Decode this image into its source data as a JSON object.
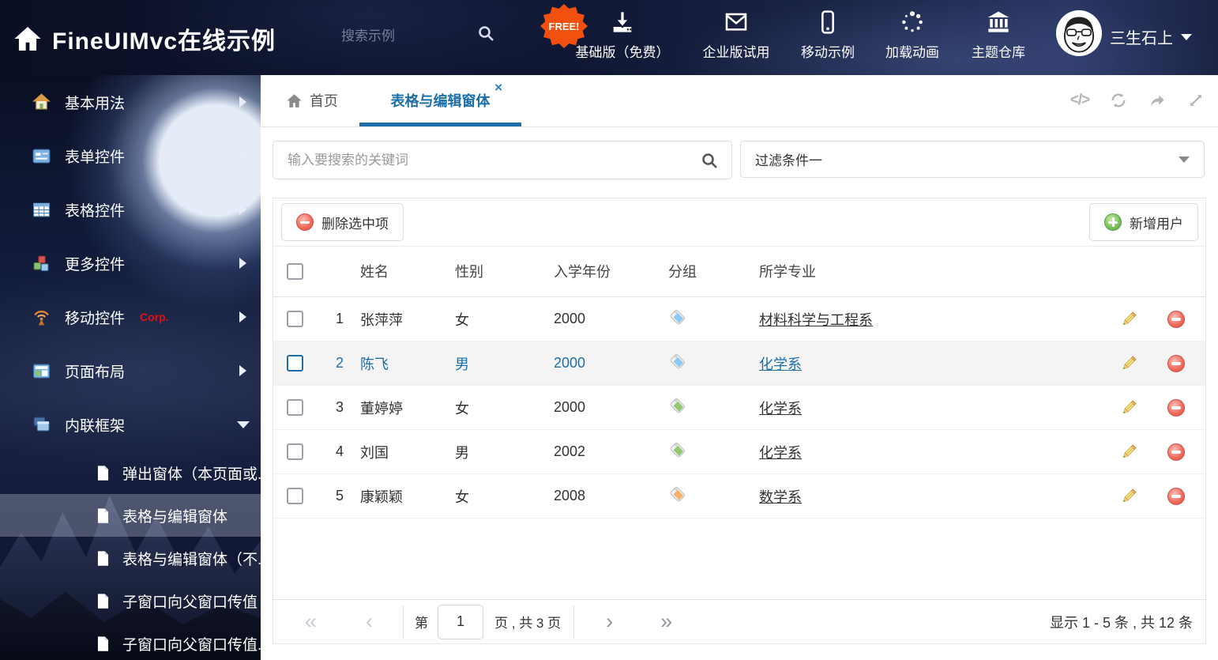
{
  "colors": {
    "accent": "#1d6fa9",
    "selected_row_bg": "#f4f4f5",
    "free_badge": "#f1500e"
  },
  "icons": {
    "close_tab": "×",
    "code": "</>",
    "first_page": "«",
    "prev_page": "‹",
    "next_page": "›",
    "last_page": "»"
  },
  "header": {
    "title": "FineUIMvc在线示例",
    "search_placeholder": "搜索示例",
    "free_badge": "FREE!",
    "nav_items": [
      {
        "label": "基础版（免费）",
        "icon": "download-icon"
      },
      {
        "label": "企业版试用",
        "icon": "envelope-icon"
      },
      {
        "label": "移动示例",
        "icon": "mobile-icon"
      },
      {
        "label": "加载动画",
        "icon": "spinner-icon"
      },
      {
        "label": "主题仓库",
        "icon": "bank-icon"
      }
    ],
    "user_name": "三生石上"
  },
  "sidebar": {
    "items": [
      {
        "label": "基本用法"
      },
      {
        "label": "表单控件"
      },
      {
        "label": "表格控件"
      },
      {
        "label": "更多控件"
      },
      {
        "label": "移动控件",
        "badge": "Corp."
      },
      {
        "label": "页面布局"
      },
      {
        "label": "内联框架",
        "expanded": true
      }
    ],
    "subitems": [
      {
        "label": "弹出窗体（本页面或...",
        "active": false
      },
      {
        "label": "表格与编辑窗体",
        "active": true
      },
      {
        "label": "表格与编辑窗体（不...",
        "active": false
      },
      {
        "label": "子窗口向父窗口传值",
        "active": false
      },
      {
        "label": "子窗口向父窗口传值...",
        "active": false
      }
    ]
  },
  "tabs": {
    "home": "首页",
    "active_tab": "表格与编辑窗体"
  },
  "filter": {
    "search_placeholder": "输入要搜索的关键词",
    "dropdown_value": "过滤条件一"
  },
  "grid": {
    "delete_button": "删除选中项",
    "add_button": "新增用户",
    "columns": [
      "姓名",
      "性别",
      "入学年份",
      "分组",
      "所学专业"
    ],
    "rows": [
      {
        "num": "1",
        "name": "张萍萍",
        "gender": "女",
        "year": "2000",
        "tag_color": "#8cc8ef",
        "major": "材料科学与工程系",
        "selected": false
      },
      {
        "num": "2",
        "name": "陈飞",
        "gender": "男",
        "year": "2000",
        "tag_color": "#8cc8ef",
        "major": "化学系",
        "selected": true
      },
      {
        "num": "3",
        "name": "董婷婷",
        "gender": "女",
        "year": "2000",
        "tag_color": "#94c973",
        "major": "化学系",
        "selected": false
      },
      {
        "num": "4",
        "name": "刘国",
        "gender": "男",
        "year": "2002",
        "tag_color": "#94c973",
        "major": "化学系",
        "selected": false
      },
      {
        "num": "5",
        "name": "康颖颖",
        "gender": "女",
        "year": "2008",
        "tag_color": "#f6b06e",
        "major": "数学系",
        "selected": false
      }
    ],
    "pagination": {
      "page_prefix": "第",
      "current_page": "1",
      "page_suffix": "页 , 共 3 页",
      "summary": "显示 1 - 5 条 , 共 12 条"
    }
  }
}
